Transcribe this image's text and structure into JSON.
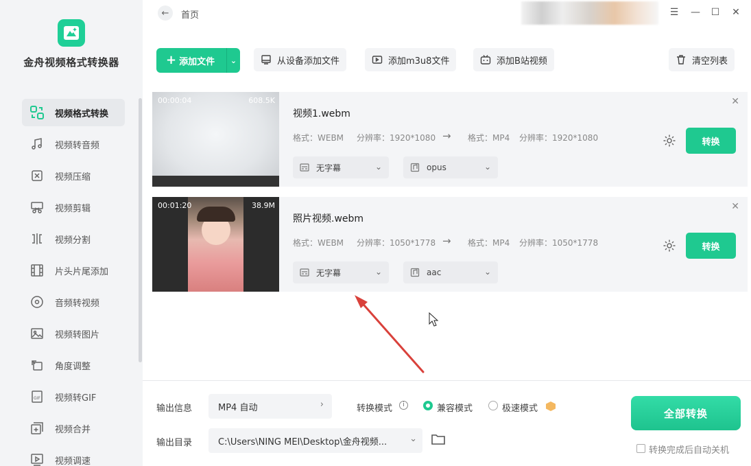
{
  "app": {
    "name": "金舟视频格式转换器"
  },
  "sidebar": {
    "items": [
      {
        "label": "视频格式转换",
        "icon": "format-convert-icon"
      },
      {
        "label": "视频转音频",
        "icon": "audio-icon"
      },
      {
        "label": "视频压缩",
        "icon": "compress-icon"
      },
      {
        "label": "视频剪辑",
        "icon": "scissors-icon"
      },
      {
        "label": "视频分割",
        "icon": "split-icon"
      },
      {
        "label": "片头片尾添加",
        "icon": "film-icon"
      },
      {
        "label": "音频转视频",
        "icon": "disc-icon"
      },
      {
        "label": "视频转图片",
        "icon": "image-icon"
      },
      {
        "label": "角度调整",
        "icon": "rotate-icon"
      },
      {
        "label": "视频转GIF",
        "icon": "gif-icon"
      },
      {
        "label": "视频合并",
        "icon": "merge-icon"
      },
      {
        "label": "视频调速",
        "icon": "speed-icon"
      }
    ]
  },
  "header": {
    "breadcrumb": "首页"
  },
  "toolbar": {
    "add_file": "添加文件",
    "add_from_device": "从设备添加文件",
    "add_m3u8": "添加m3u8文件",
    "add_bilibili": "添加B站视频",
    "clear_list": "清空列表"
  },
  "files": [
    {
      "duration": "00:00:04",
      "size": "608.5K",
      "name": "视频1.webm",
      "src_format": "格式：WEBM",
      "src_res": "分辨率：1920*1080",
      "dst_format": "格式：MP4",
      "dst_res": "分辨率：1920*1080",
      "subtitle": "无字幕",
      "audio": "opus",
      "convert": "转换"
    },
    {
      "duration": "00:01:20",
      "size": "38.9M",
      "name": "照片视频.webm",
      "src_format": "格式：WEBM",
      "src_res": "分辨率：1050*1778",
      "dst_format": "格式：MP4",
      "dst_res": "分辨率：1050*1778",
      "subtitle": "无字幕",
      "audio": "aac",
      "convert": "转换"
    }
  ],
  "bottom": {
    "output_info_label": "输出信息",
    "output_info_value": "MP4 自动",
    "mode_label": "转换模式",
    "mode_compat": "兼容模式",
    "mode_fast": "极速模式",
    "output_dir_label": "输出目录",
    "output_dir_value": "C:\\Users\\NING MEI\\Desktop\\金舟视频...",
    "convert_all": "全部转换",
    "auto_shutdown": "转换完成后自动关机"
  },
  "colors": {
    "accent": "#1fc990",
    "annotation_arrow": "#d9413b"
  }
}
